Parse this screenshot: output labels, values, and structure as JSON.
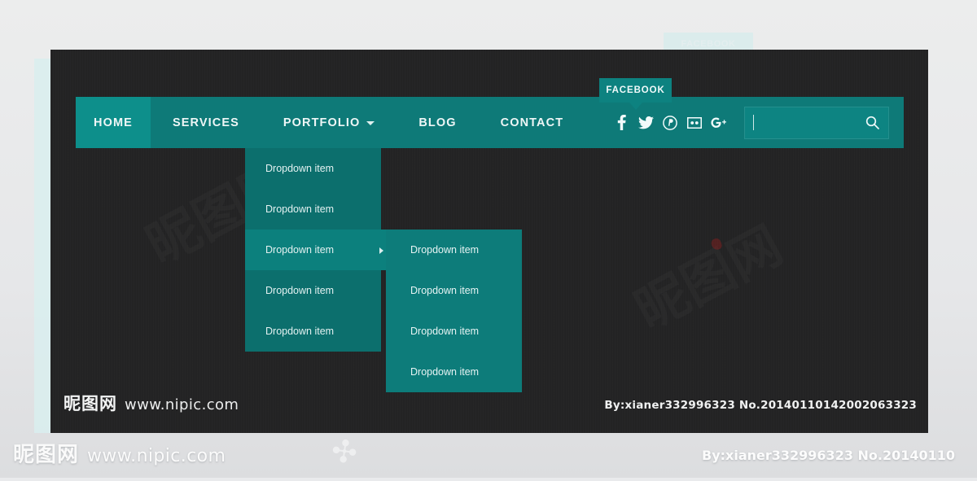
{
  "navbar": {
    "items": [
      {
        "label": "HOME",
        "active": true,
        "has_caret": false
      },
      {
        "label": "SERVICES",
        "active": false,
        "has_caret": false
      },
      {
        "label": "PORTFOLIO",
        "active": false,
        "has_caret": true
      },
      {
        "label": "BLOG",
        "active": false,
        "has_caret": false
      },
      {
        "label": "CONTACT",
        "active": false,
        "has_caret": false
      }
    ],
    "social": [
      {
        "name": "facebook",
        "glyph": "f"
      },
      {
        "name": "twitter",
        "glyph": "t"
      },
      {
        "name": "pinterest",
        "glyph": "p"
      },
      {
        "name": "flickr",
        "glyph": "fl"
      },
      {
        "name": "googleplus",
        "glyph": "g+"
      }
    ],
    "tooltip": "FACEBOOK",
    "colors": {
      "bar": "#0e7a78",
      "active_tab": "#0d8f8b",
      "dropdown": "#0c6f6d",
      "dropdown_hover": "#0c807d",
      "submenu": "#0d7c7a",
      "panel_bg": "#232324",
      "page_bg": "#e9eaec"
    }
  },
  "search": {
    "value": "",
    "placeholder": "",
    "icon": "search-icon"
  },
  "dropdown": {
    "items": [
      {
        "label": "Dropdown item",
        "active": false,
        "has_submenu": false
      },
      {
        "label": "Dropdown item",
        "active": false,
        "has_submenu": false
      },
      {
        "label": "Dropdown item",
        "active": true,
        "has_submenu": true
      },
      {
        "label": "Dropdown item",
        "active": false,
        "has_submenu": false
      },
      {
        "label": "Dropdown item",
        "active": false,
        "has_submenu": false
      }
    ]
  },
  "submenu": {
    "items": [
      {
        "label": "Dropdown item"
      },
      {
        "label": "Dropdown item"
      },
      {
        "label": "Dropdown item"
      },
      {
        "label": "Dropdown item"
      }
    ]
  },
  "watermark": {
    "brand_cn": "昵图网",
    "url": "www.nipic.com",
    "credit": "By:xianer332996323  No.20140110142002063323",
    "credit_outer": "By:xianer332996323  No.20140110",
    "ghost_tooltip": "FACEBOOK"
  }
}
